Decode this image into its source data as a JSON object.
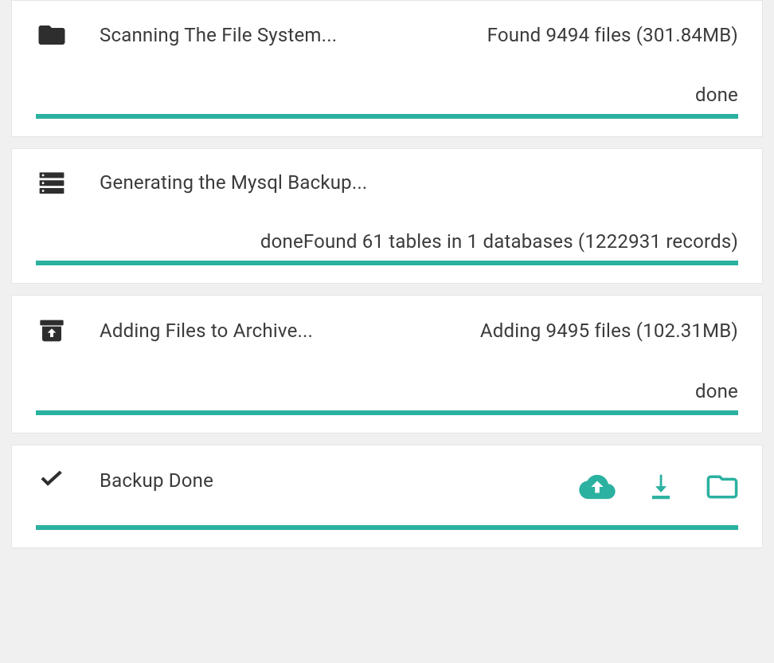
{
  "steps": [
    {
      "title": "Scanning The File System...",
      "detail": "Found 9494 files (301.84MB)",
      "status": "done"
    },
    {
      "title": "Generating the Mysql Backup...",
      "detail": "",
      "status": "doneFound 61 tables in 1 databases (1222931 records)"
    },
    {
      "title": "Adding Files to Archive...",
      "detail": "Adding 9495 files (102.31MB)",
      "status": "done"
    },
    {
      "title": "Backup Done",
      "detail": "",
      "status": ""
    }
  ],
  "icons": {
    "folder": "folder-icon",
    "database": "database-icon",
    "archive": "archive-icon",
    "check": "check-icon",
    "cloud_upload": "cloud-upload-icon",
    "download": "download-icon",
    "folder_open": "folder-open-icon"
  },
  "colors": {
    "accent": "#2bb1a0",
    "text": "#3b3b3b",
    "iconDark": "#2e2e2e"
  }
}
